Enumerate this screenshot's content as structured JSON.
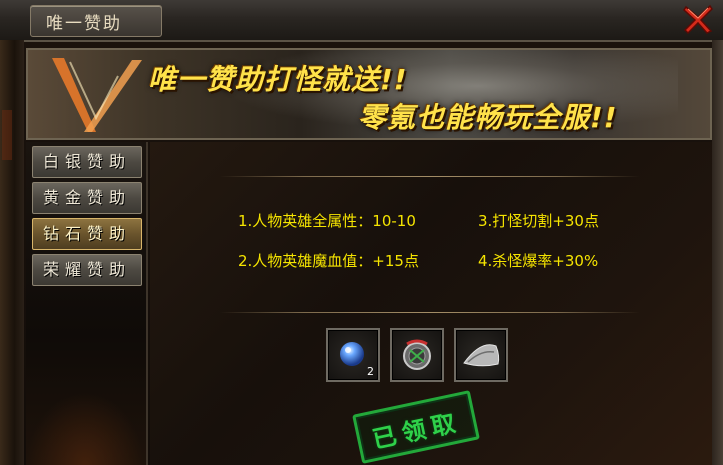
{
  "window": {
    "title": "唯一赞助"
  },
  "banner": {
    "line1": "唯一赞助打怪就送!!",
    "line2": "零氪也能畅玩全服!!"
  },
  "sidebar": {
    "items": [
      {
        "label": "白银赞助",
        "active": false
      },
      {
        "label": "黄金赞助",
        "active": false
      },
      {
        "label": "钻石赞助",
        "active": true
      },
      {
        "label": "荣耀赞助",
        "active": false
      }
    ]
  },
  "bonuses": [
    "1.人物英雄全属性：10-10",
    "3.打怪切割+30点",
    "2.人物英雄魔血值：+15点",
    "4.杀怪爆率+30%"
  ],
  "rewards": [
    {
      "icon": "blue-orb-icon",
      "count": "2"
    },
    {
      "icon": "medal-icon",
      "count": ""
    },
    {
      "icon": "silver-hat-icon",
      "count": ""
    }
  ],
  "status_stamp": "已领取",
  "colors": {
    "bonus_text": "#f5e400",
    "banner_text": "#ffe24a",
    "stamp": "#23a83a",
    "close_icon": "#d42a1a"
  }
}
